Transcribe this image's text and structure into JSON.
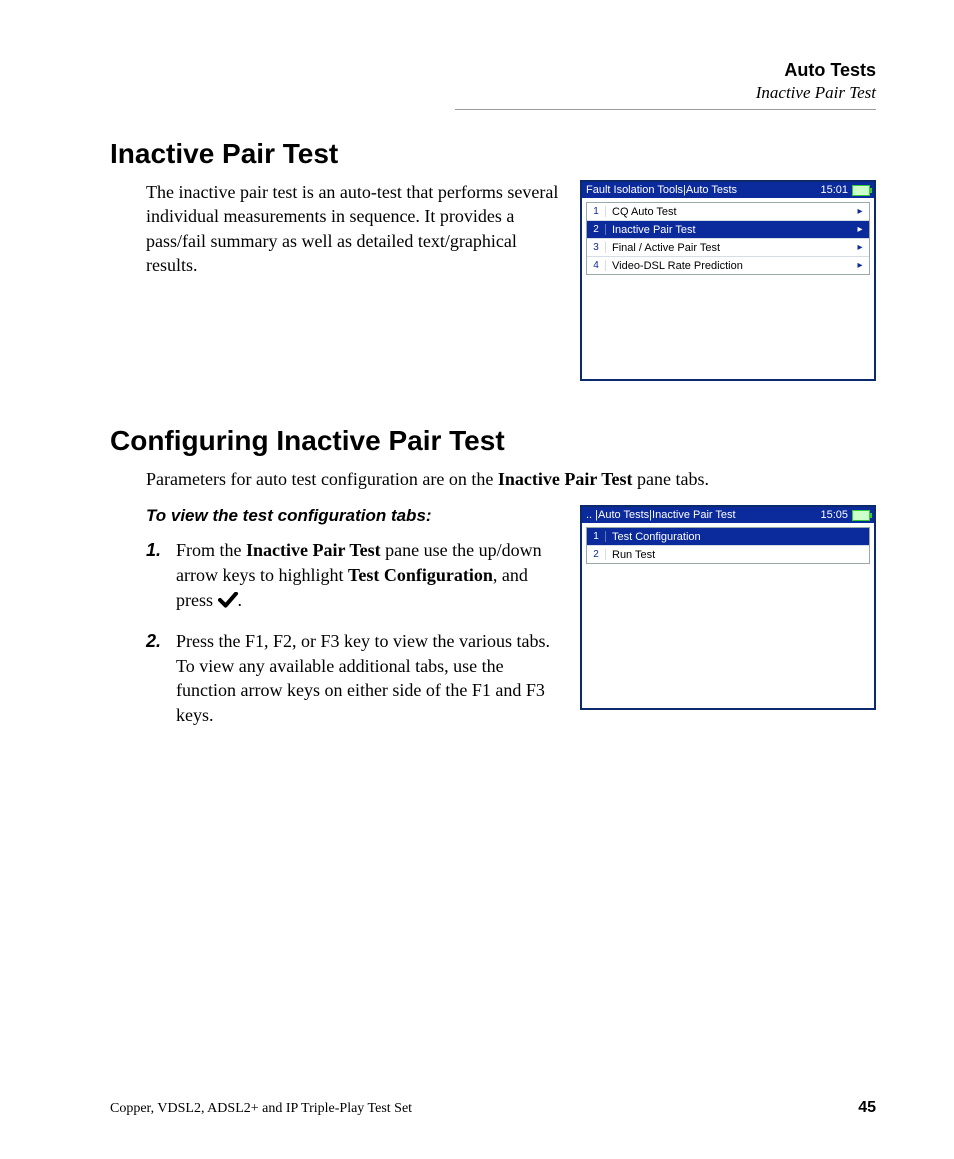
{
  "header": {
    "chapter": "Auto Tests",
    "section": "Inactive Pair Test"
  },
  "s1": {
    "heading": "Inactive Pair Test",
    "para": "The inactive pair test is an auto-test that performs several individual measurements in sequence. It provides a pass/fail summary as well as detailed text/graphical results."
  },
  "fig1": {
    "title": "Fault Isolation Tools|Auto Tests",
    "time": "15:01",
    "items": [
      {
        "n": "1",
        "label": "CQ Auto Test",
        "arrow": true,
        "selected": false
      },
      {
        "n": "2",
        "label": "Inactive Pair Test",
        "arrow": true,
        "selected": true
      },
      {
        "n": "3",
        "label": "Final / Active Pair Test",
        "arrow": true,
        "selected": false
      },
      {
        "n": "4",
        "label": "Video-DSL Rate Prediction",
        "arrow": true,
        "selected": false
      }
    ]
  },
  "s2": {
    "heading": "Configuring Inactive Pair Test",
    "intro_a": "Parameters for auto test configuration are on the ",
    "intro_b": "Inactive Pair Test",
    "intro_c": " pane tabs.",
    "task": "To view the test configuration tabs:",
    "step1_a": "From the ",
    "step1_b": "Inactive Pair Test",
    "step1_c": " pane use the up/down arrow keys to highlight ",
    "step1_d": "Test Configuration",
    "step1_e": ", and press ",
    "step1_f": ".",
    "step2": "Press the F1, F2, or F3 key to view the various tabs. To view any available additional tabs, use the function arrow keys on either side of the F1 and F3 keys."
  },
  "fig2": {
    "title": ".. |Auto Tests|Inactive Pair Test",
    "time": "15:05",
    "items": [
      {
        "n": "1",
        "label": "Test Configuration",
        "arrow": false,
        "selected": true
      },
      {
        "n": "2",
        "label": "Run Test",
        "arrow": false,
        "selected": false
      }
    ]
  },
  "footer": {
    "left": "Copper, VDSL2, ADSL2+ and IP Triple-Play Test Set",
    "page": "45"
  },
  "glyphs": {
    "arrow": "▸"
  }
}
